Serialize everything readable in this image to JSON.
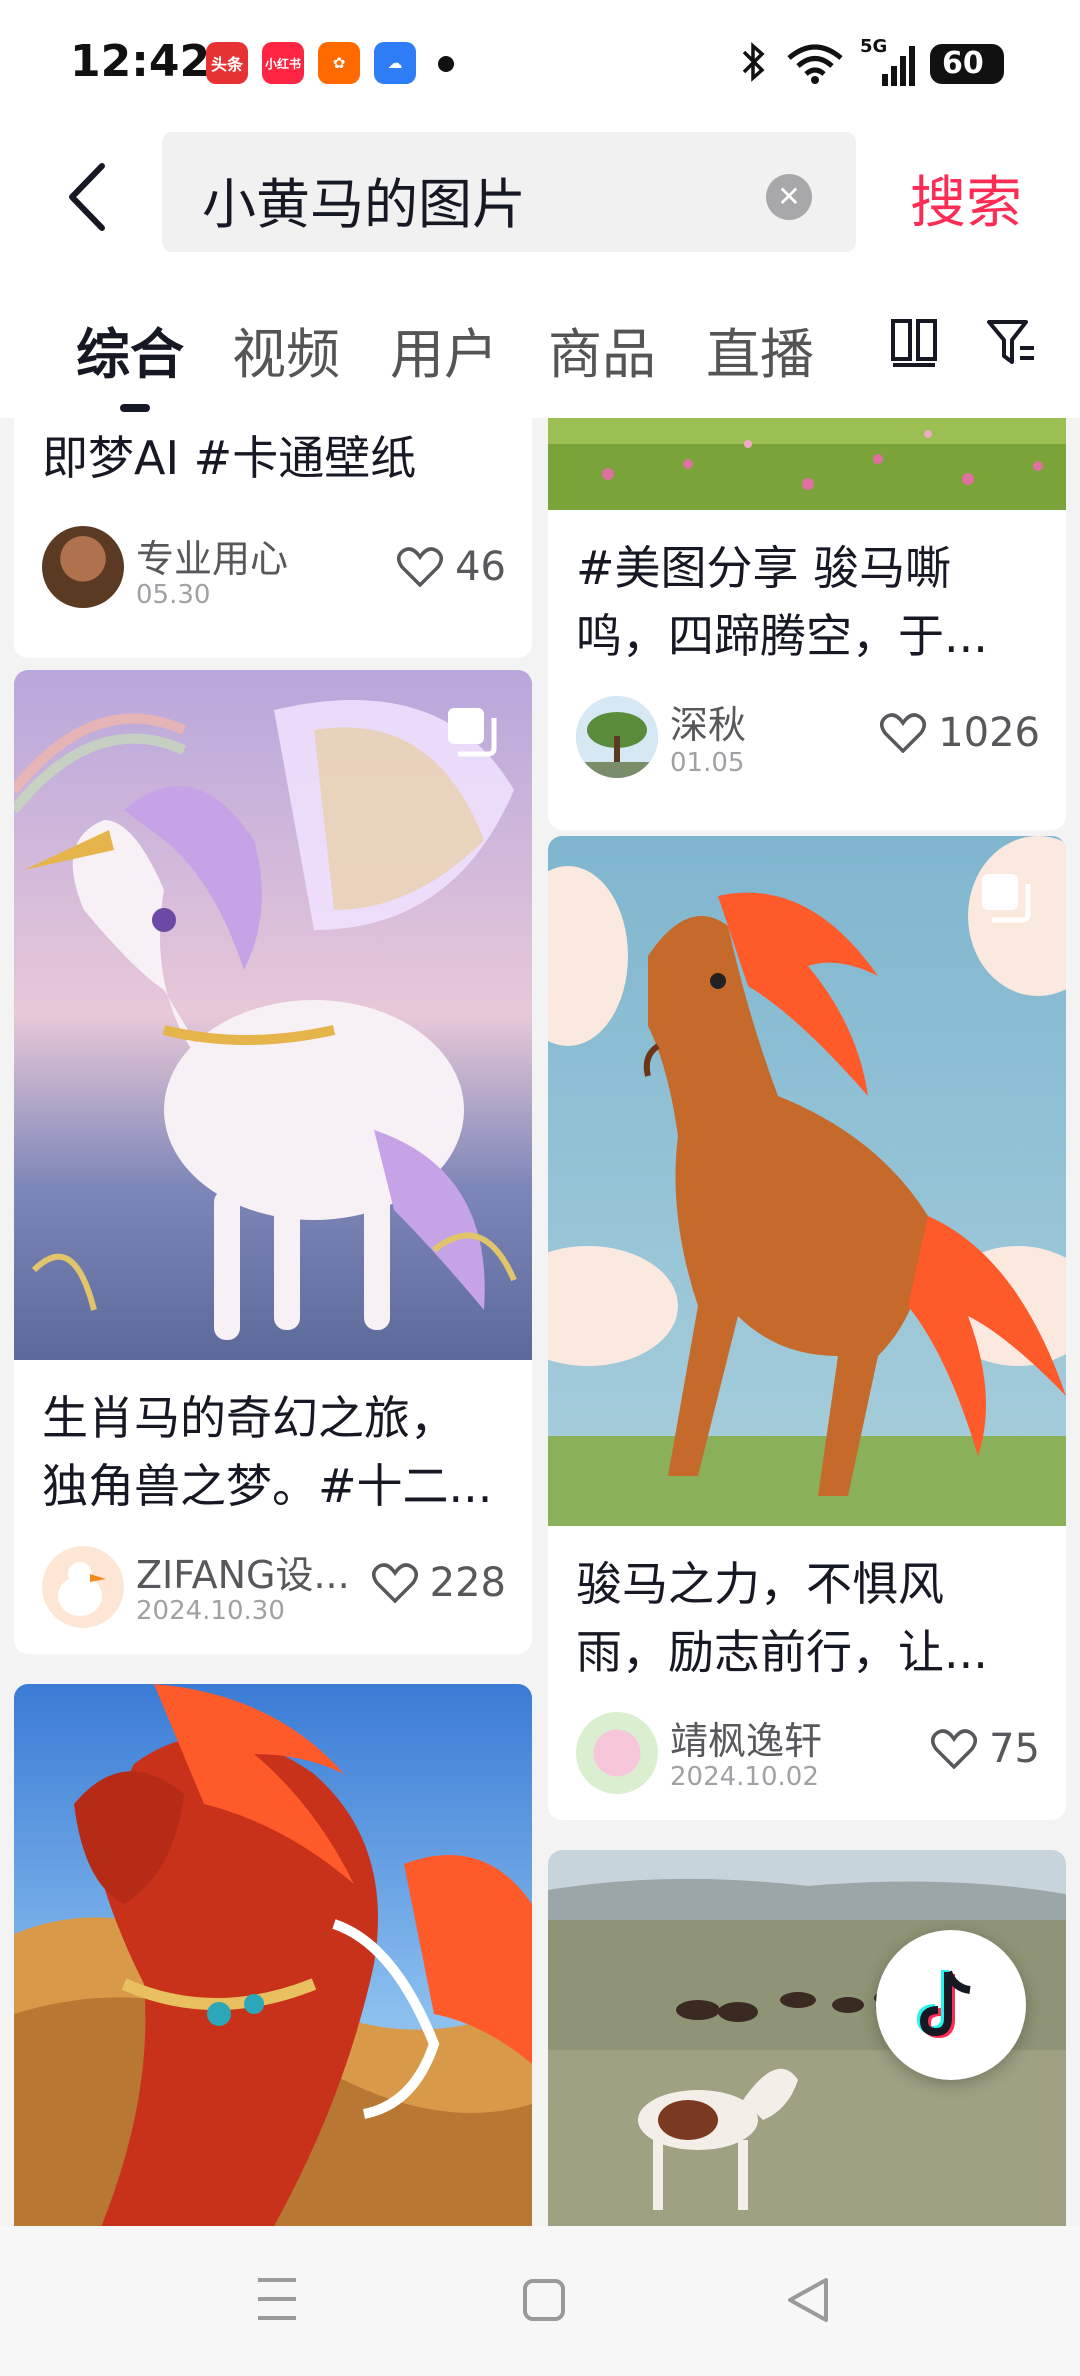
{
  "status_bar": {
    "time": "12:42",
    "app_icons": [
      {
        "name": "toutiao-icon",
        "label": "头条",
        "color": "#e63232"
      },
      {
        "name": "xiaohongshu-icon",
        "label": "小红书",
        "color": "#ff2442"
      },
      {
        "name": "taobao-app-icon",
        "label": "",
        "color": "#ff6a00"
      },
      {
        "name": "baidu-netdisk-icon",
        "label": "",
        "color": "#2e7cf6"
      }
    ],
    "network": "5G",
    "battery": "60"
  },
  "search": {
    "query": "小黄马的图片",
    "button_label": "搜索"
  },
  "tabs": [
    {
      "label": "综合",
      "active": true
    },
    {
      "label": "视频",
      "active": false
    },
    {
      "label": "用户",
      "active": false
    },
    {
      "label": "商品",
      "active": false
    },
    {
      "label": "直播",
      "active": false
    }
  ],
  "feed": {
    "left": [
      {
        "title_partial": "即梦AI #卡通壁纸",
        "author": "专业用心",
        "date": "05.30",
        "likes": "46"
      },
      {
        "title": "生肖马的奇幻之旅，独角兽之梦。#十二...",
        "title_lines": [
          "生肖马的奇幻之旅，",
          "独角兽之梦。#十二..."
        ],
        "author": "ZIFANG设...",
        "date": "2024.10.30",
        "likes": "228",
        "image": "unicorn-image"
      },
      {
        "image": "red-horse-desert-image"
      }
    ],
    "right": [
      {
        "title_lines": [
          "#美图分享 骏马嘶",
          "鸣，四蹄腾空，于..."
        ],
        "author": "深秋",
        "date": "01.05",
        "likes": "1026",
        "image": "meadow-image"
      },
      {
        "title_lines": [
          "骏马之力，不惧风",
          "雨，励志前行，让..."
        ],
        "author": "靖枫逸轩",
        "date": "2024.10.02",
        "likes": "75",
        "image": "chestnut-horse-image"
      },
      {
        "image": "grassland-horses-image"
      }
    ]
  },
  "accent_color": "#fe2c55"
}
